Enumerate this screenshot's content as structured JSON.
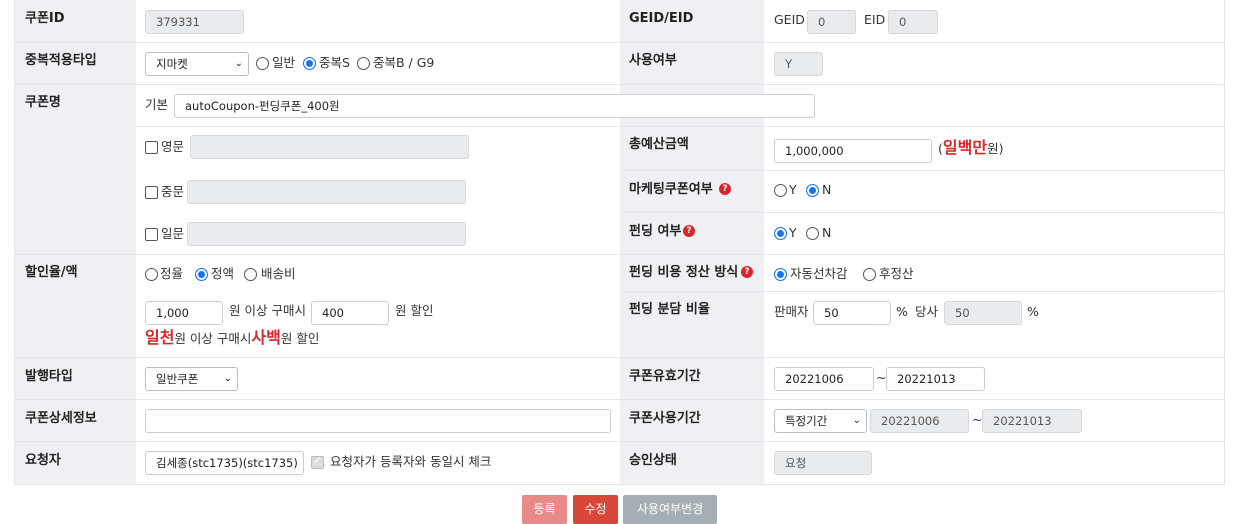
{
  "coupon_id": {
    "label": "쿠폰ID",
    "value": "379331"
  },
  "geid": {
    "label": "GEID/EID",
    "geid_label": "GEID",
    "geid_value": "0",
    "eid_label": "EID",
    "eid_value": "0"
  },
  "dup_type": {
    "label": "중복적용타입",
    "select": "지마켓",
    "options": [
      "일반",
      "중복S",
      "중복B / G9"
    ],
    "selected_index": 1
  },
  "use_yn": {
    "label": "사용여부",
    "value": "Y"
  },
  "coupon_name": {
    "label": "쿠폰명",
    "basic_label": "기본",
    "basic_value": "autoCoupon-펀딩쿠폰_400원",
    "en_label": "영문",
    "cn_label": "중문",
    "jp_label": "일문"
  },
  "budget": {
    "label": "총예산금액",
    "value": "1,000,000",
    "paren_open": "(",
    "korean": "일백만",
    "unit": "원)"
  },
  "marketing": {
    "label": "마케팅쿠폰여부",
    "icon": "?",
    "options": [
      "Y",
      "N"
    ],
    "selected_index": 1
  },
  "funding": {
    "label": "펀딩 여부",
    "icon": "?",
    "options": [
      "Y",
      "N"
    ],
    "selected_index": 0
  },
  "discount": {
    "label": "할인율/액",
    "options": [
      "정율",
      "정액",
      "배송비"
    ],
    "selected_index": 1,
    "min_value": "1,000",
    "text1": "원 이상 구매시",
    "amount": "400",
    "text2": "원 할인",
    "kor_min": "일천",
    "kor_mid": "원 이상 구매시",
    "kor_amount": "사백",
    "kor_end": "원 할인"
  },
  "settlement": {
    "label": "펀딩 비용 정산 방식",
    "icon": "?",
    "options": [
      "자동선차감",
      "후정산"
    ],
    "selected_index": 0
  },
  "ratio": {
    "label": "펀딩 분담 비율",
    "seller_label": "판매자",
    "seller_value": "50",
    "pct": "%",
    "company_label": "당사",
    "company_value": "50"
  },
  "issue_type": {
    "label": "발행타입",
    "select": "일반쿠폰"
  },
  "valid_period": {
    "label": "쿠폰유효기간",
    "start": "20221006",
    "tilde": "~",
    "end": "20221013"
  },
  "detail": {
    "label": "쿠폰상세정보",
    "value": ""
  },
  "use_period": {
    "label": "쿠폰사용기간",
    "select": "특정기간",
    "start": "20221006",
    "tilde": "~",
    "end": "20221013"
  },
  "requester": {
    "label": "요청자",
    "value": "김세종(stc1735)(stc1735)",
    "check_label": "요청자가 등록자와 동일시 체크"
  },
  "approval": {
    "label": "승인상태",
    "value": "요청"
  },
  "buttons": {
    "register": "등록",
    "edit": "수정",
    "change_use": "사용여부변경"
  },
  "colors": {
    "accent_red": "#d9262c",
    "primary_blue": "#1a73e8",
    "label_bg": "#eef0f3"
  }
}
